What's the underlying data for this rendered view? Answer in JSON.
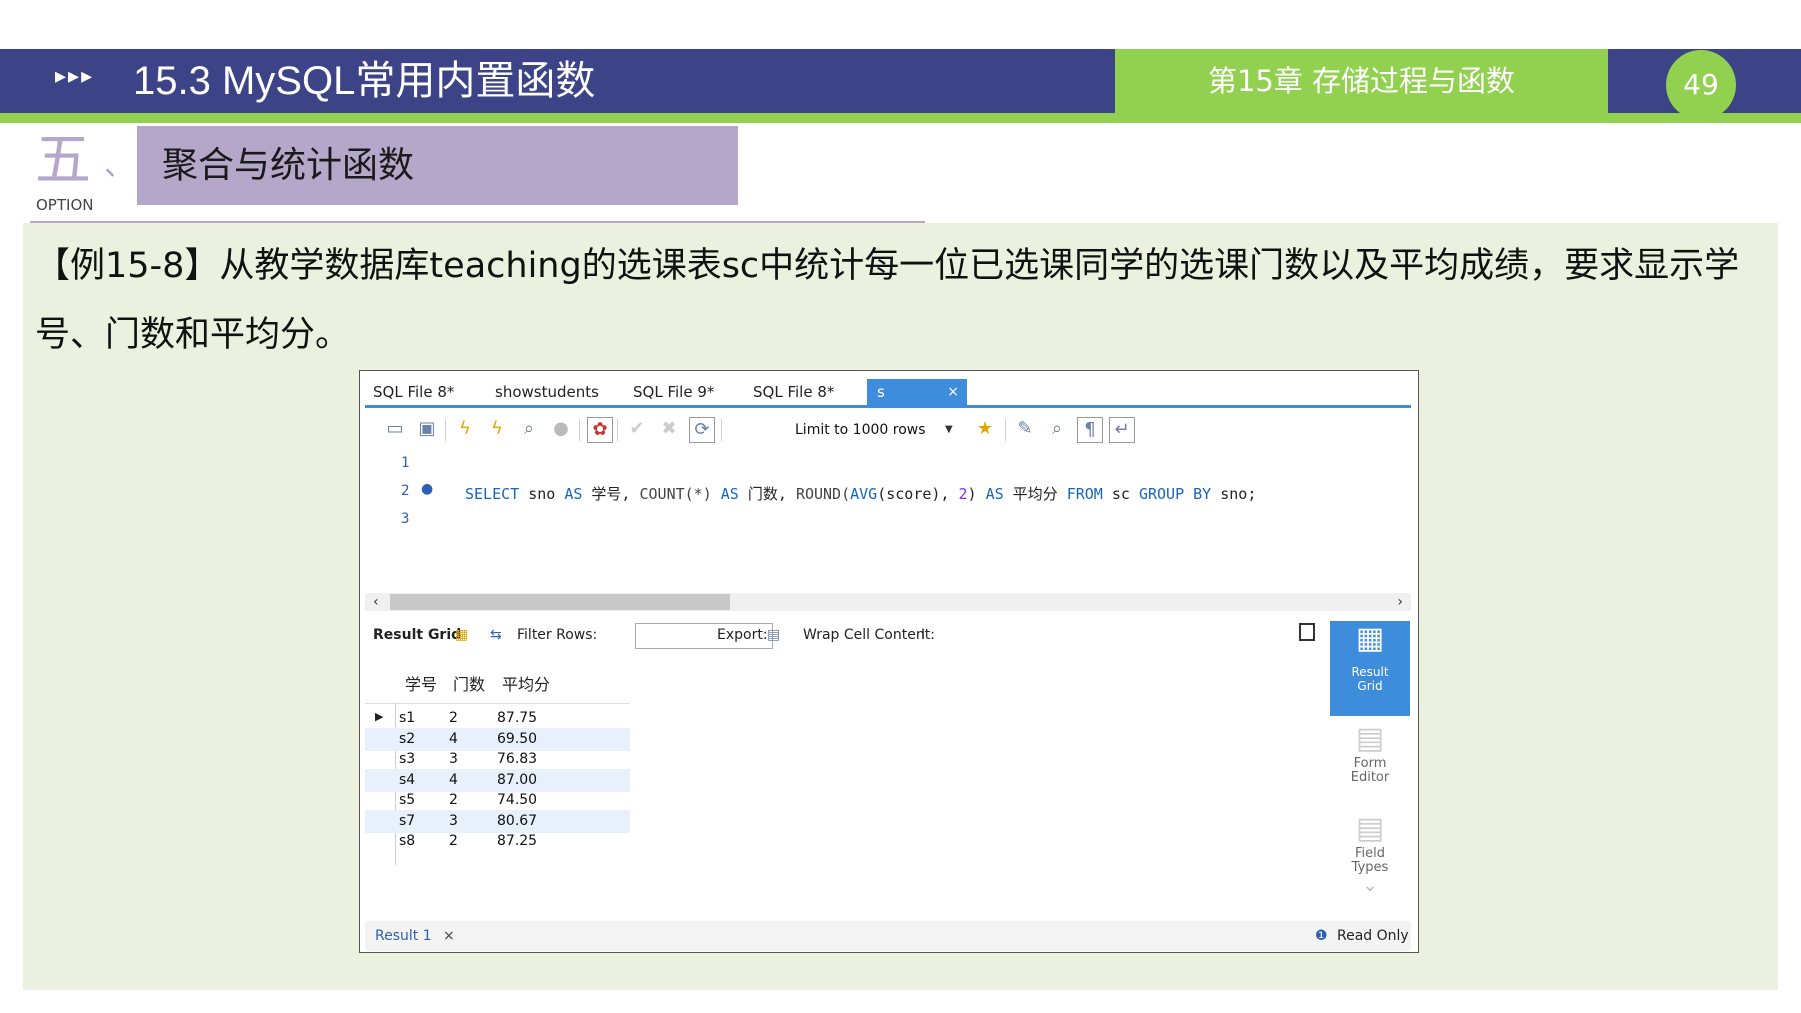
{
  "header": {
    "arrows": "▸▸▸",
    "title": "15.3 MySQL常用内置函数",
    "chapter": "第15章 存储过程与函数",
    "page_number": "49"
  },
  "section": {
    "number": "五",
    "comma": "、",
    "option": "OPTION",
    "title": "聚合与统计函数"
  },
  "paragraph": "【例15-8】从教学数据库teaching的选课表sc中统计每一位已选课同学的选课门数以及平均成绩，要求显示学号、门数和平均分。",
  "app": {
    "tabs": [
      "SQL File 8*",
      "showstudents",
      "SQL File 9*",
      "SQL File 8*",
      "s"
    ],
    "active_tab_close": "×",
    "limit_select": "Limit to 1000 rows",
    "line_numbers": [
      "1",
      "2",
      "3"
    ],
    "line2_marker": "●",
    "code": {
      "select": "SELECT",
      "col1": " sno ",
      "as1": "AS",
      "alias1": " 学号, ",
      "count": "COUNT(*)",
      "sp1": " ",
      "as2": "AS",
      "alias2": " 门数, ",
      "round": "ROUND(",
      "avg": "AVG",
      "avgarg": "(score), ",
      "two": "2",
      "close": ") ",
      "as3": "AS",
      "alias3": " 平均分 ",
      "from": "FROM",
      "table": " sc ",
      "group": "GROUP BY",
      "tail": " sno;"
    },
    "result_bar": {
      "result_grid": "Result Grid",
      "filter_rows": "Filter Rows:",
      "export": "Export:",
      "wrap": "Wrap Cell Content:"
    },
    "grid": {
      "columns": [
        "学号",
        "门数",
        "平均分"
      ],
      "rows": [
        [
          "s1",
          "2",
          "87.75"
        ],
        [
          "s2",
          "4",
          "69.50"
        ],
        [
          "s3",
          "3",
          "76.83"
        ],
        [
          "s4",
          "4",
          "87.00"
        ],
        [
          "s5",
          "2",
          "74.50"
        ],
        [
          "s7",
          "3",
          "80.67"
        ],
        [
          "s8",
          "2",
          "87.25"
        ]
      ]
    },
    "side_panel": {
      "result_grid": "Result\nGrid",
      "form_editor": "Form\nEditor",
      "field_types": "Field\nTypes"
    },
    "bottom": {
      "result_tab": "Result 1",
      "close": "×",
      "read_only": "Read Only"
    }
  }
}
